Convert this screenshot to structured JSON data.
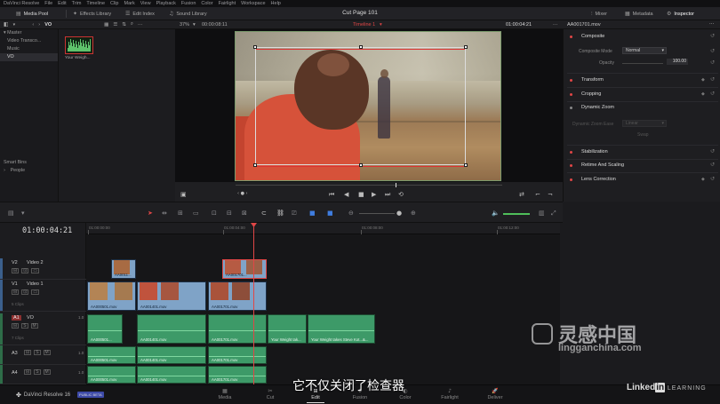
{
  "menu": [
    "DaVinci Resolve",
    "File",
    "Edit",
    "Trim",
    "Timeline",
    "Clip",
    "Mark",
    "View",
    "Playback",
    "Fusion",
    "Color",
    "Fairlight",
    "Workspace",
    "Help"
  ],
  "toolbar": {
    "media_pool": "Media Pool",
    "effects_library": "Effects Library",
    "edit_index": "Edit Index",
    "sound_library": "Sound Library",
    "project_title": "Cut Page 101",
    "mixer": "Mixer",
    "metadata": "Metadata",
    "inspector": "Inspector"
  },
  "media_pool": {
    "current_bin": "VO",
    "bins": [
      "Master",
      "Video Transco...",
      "Music",
      "VO"
    ],
    "smart_bins_label": "Smart Bins",
    "smart_bins": [
      "People"
    ],
    "clip_name": "Your Weigh..."
  },
  "viewer": {
    "zoom": "37%",
    "source_timecode": "00:00:08:11",
    "timeline_name": "Timeline 1",
    "record_timecode": "01:00:04:21",
    "clip_name": "AA001701.mov"
  },
  "inspector": {
    "sections": [
      {
        "label": "Composite",
        "enabled": true
      },
      {
        "label": "Transform",
        "enabled": true
      },
      {
        "label": "Cropping",
        "enabled": true
      },
      {
        "label": "Dynamic Zoom",
        "enabled": false
      },
      {
        "label": "Stabilization",
        "enabled": true
      },
      {
        "label": "Retime And Scaling",
        "enabled": true
      },
      {
        "label": "Lens Correction",
        "enabled": true
      }
    ],
    "composite_mode_label": "Composite Mode",
    "composite_mode_value": "Normal",
    "opacity_label": "Opacity",
    "opacity_value": "100.00",
    "dz_ease_label": "Dynamic Zoom Ease",
    "dz_ease_value": "Linear",
    "swap_label": "Swap"
  },
  "timeline": {
    "timecode": "01:00:04:21",
    "ruler_labels": [
      "01:00:00:00",
      "01:00:04:00",
      "01:00:08:00",
      "01:00:12:00"
    ],
    "tracks": [
      {
        "id": "V2",
        "name": "Video 2",
        "clips": ""
      },
      {
        "id": "V1",
        "name": "Video 1",
        "clips": "5 Clips"
      },
      {
        "id": "A1",
        "name": "VO",
        "vol": "1.0",
        "clips": "7 Clips"
      },
      {
        "id": "A3",
        "name": "",
        "vol": "1.0",
        "clips": ""
      },
      {
        "id": "A4",
        "name": "",
        "vol": "1.0",
        "clips": ""
      }
    ],
    "v2_clips": [
      "AA0011...",
      "AA001701..."
    ],
    "v1_clips": [
      "AA000501.mov",
      "AA001401.mov",
      "AA001701.mov"
    ],
    "a1_clips": [
      "AA000501...",
      "AA001401.mov",
      "AA001701.mov",
      "Your Weight tak...",
      "Your Weight takes Steve Kot...&..."
    ],
    "a3_clips": [
      "AA000501.mov",
      "AA001401.mov",
      "AA001701.mov"
    ],
    "a4_clips": [
      "AA000501.mov",
      "AA001401.mov",
      "AA001701.mov"
    ]
  },
  "pages": {
    "brand": "DaVinci Resolve 16",
    "beta": "PUBLIC BETA",
    "tabs": [
      "Media",
      "Cut",
      "Edit",
      "Fusion",
      "Color",
      "Fairlight",
      "Deliver"
    ],
    "active": "Edit"
  },
  "overlay": {
    "subtitle": "它不仅关闭了检查器",
    "watermark_cn": "灵感中国",
    "watermark_url": "lingganchina.com",
    "linkedin": "Linked",
    "linkedin_in": "in",
    "learning": "LEARNING"
  },
  "colors": {
    "accent_red": "#e04646",
    "video_clip": "#7fa3c7",
    "audio_clip": "#3d9a68",
    "beta_badge": "#3d4aa8"
  }
}
